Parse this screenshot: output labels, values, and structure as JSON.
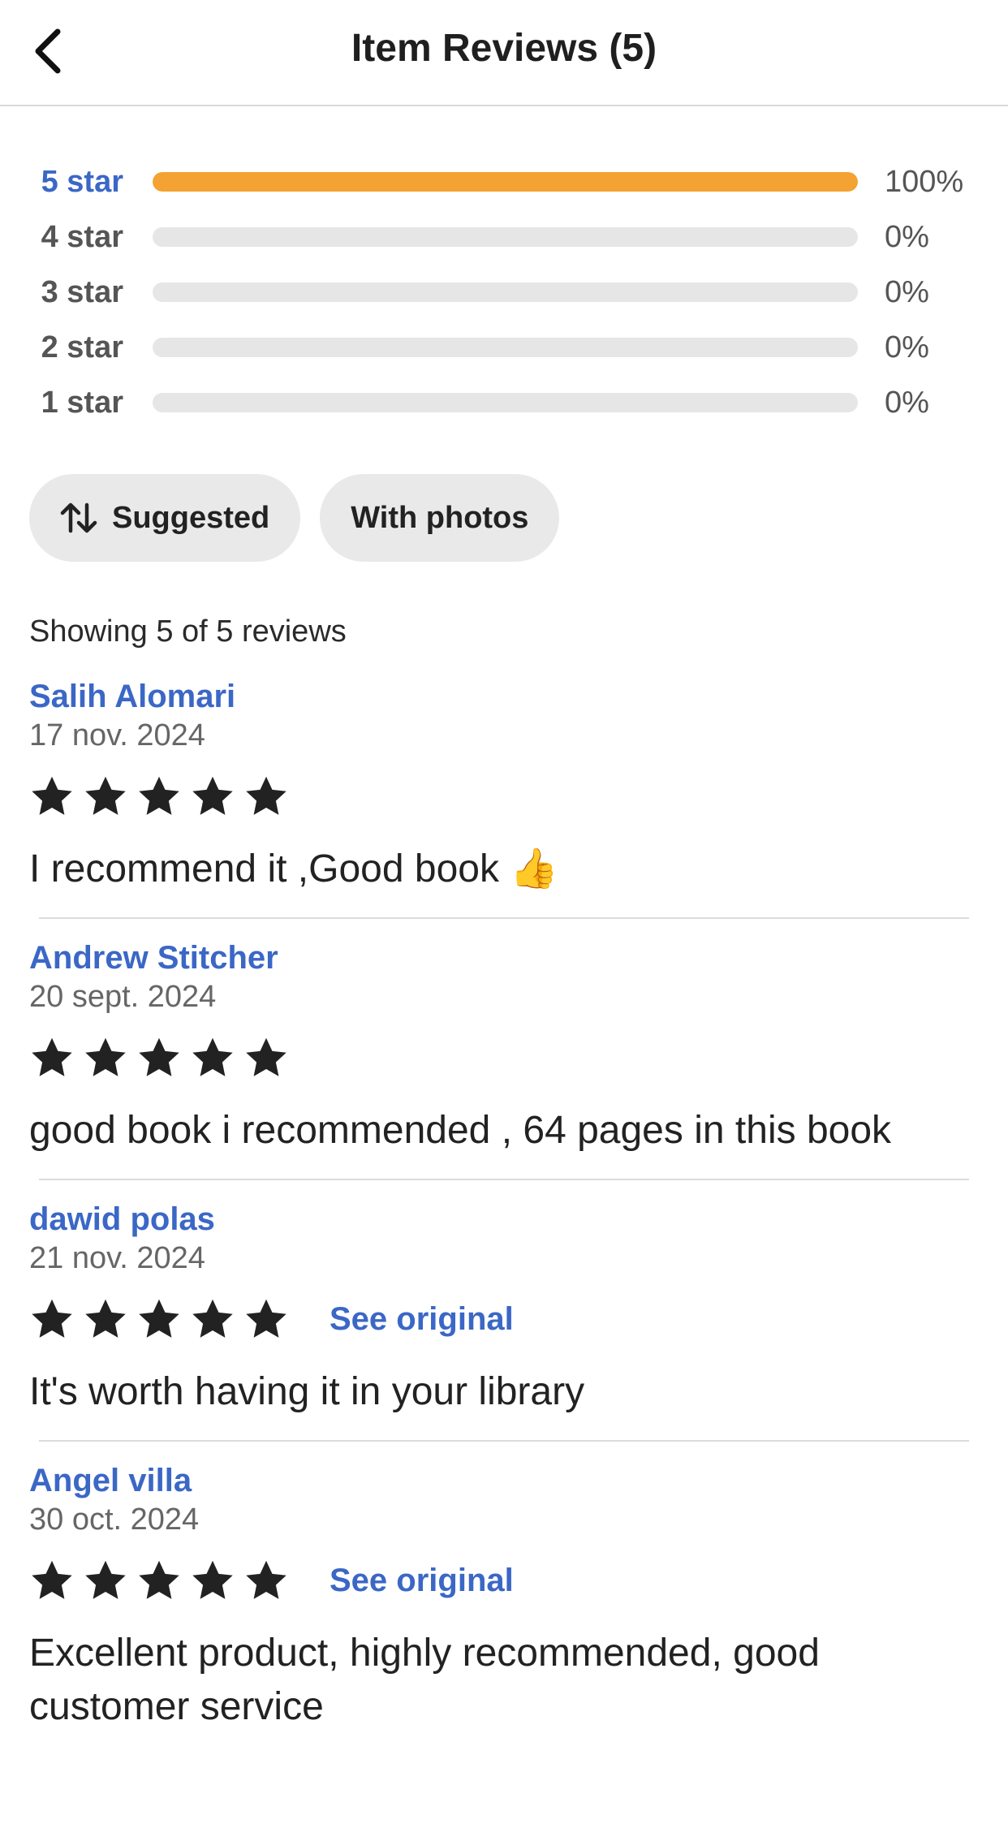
{
  "header": {
    "title": "Item Reviews (5)"
  },
  "histogram": [
    {
      "label": "5 star",
      "percent_text": "100%",
      "fraction": 1.0,
      "active": true
    },
    {
      "label": "4 star",
      "percent_text": "0%",
      "fraction": 0,
      "active": false
    },
    {
      "label": "3 star",
      "percent_text": "0%",
      "fraction": 0,
      "active": false
    },
    {
      "label": "2 star",
      "percent_text": "0%",
      "fraction": 0,
      "active": false
    },
    {
      "label": "1 star",
      "percent_text": "0%",
      "fraction": 0,
      "active": false
    }
  ],
  "filters": {
    "sort_label": "Suggested",
    "photos_label": "With photos"
  },
  "showing_text": "Showing 5 of 5 reviews",
  "reviews": [
    {
      "name": "Salih Alomari",
      "date": "17 nov. 2024",
      "stars": 5,
      "see_original": "",
      "text": "I recommend it ,Good book 👍"
    },
    {
      "name": "Andrew Stitcher",
      "date": "20 sept. 2024",
      "stars": 5,
      "see_original": "",
      "text": "good book i recommended , 64 pages in this book"
    },
    {
      "name": "dawid polas",
      "date": "21 nov. 2024",
      "stars": 5,
      "see_original": "See original",
      "text": "It's worth having it in your library"
    },
    {
      "name": "Angel villa",
      "date": "30 oct. 2024",
      "stars": 5,
      "see_original": "See original",
      "text": "Excellent product, highly recommended, good customer service"
    }
  ],
  "colors": {
    "accent_blue": "#3b67c6",
    "bar_fill": "#f4a231",
    "bar_track": "#e6e6e6",
    "chip_bg": "#e9e9e9"
  },
  "icons": {
    "back": "chevron-left-icon",
    "sort": "sort-arrows-icon",
    "star": "star-icon"
  }
}
